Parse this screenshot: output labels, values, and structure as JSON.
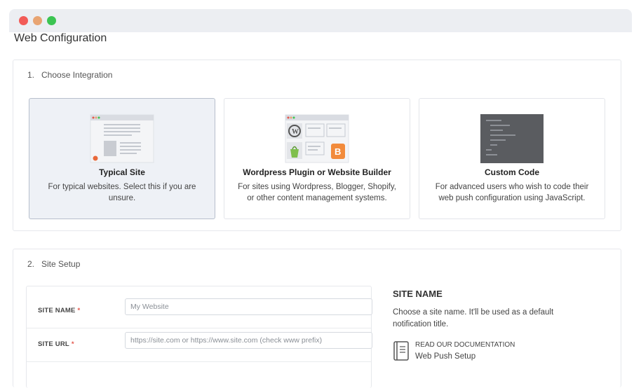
{
  "page": {
    "title": "Web Configuration"
  },
  "section1": {
    "number": "1.",
    "title": "Choose Integration",
    "cards": [
      {
        "title": "Typical Site",
        "description": "For typical websites. Select this if you are unsure.",
        "selected": true,
        "icon": "browser-page-illustration"
      },
      {
        "title": "Wordpress Plugin or Website Builder",
        "description": "For sites using Wordpress, Blogger, Shopify, or other content management systems.",
        "selected": false,
        "icon": "cms-logos-illustration"
      },
      {
        "title": "Custom Code",
        "description": "For advanced users who wish to code their web push configuration using JavaScript.",
        "selected": false,
        "icon": "code-editor-illustration"
      }
    ]
  },
  "section2": {
    "number": "2.",
    "title": "Site Setup",
    "fields": [
      {
        "label": "SITE NAME",
        "required": "*",
        "placeholder": "My Website",
        "value": ""
      },
      {
        "label": "SITE URL",
        "required": "*",
        "placeholder": "https://site.com or https://www.site.com (check www prefix)",
        "value": ""
      }
    ],
    "info": {
      "title": "SITE NAME",
      "description": "Choose a site name. It'll be used as a default notification title.",
      "doc_label": "READ OUR DOCUMENTATION",
      "doc_link": "Web Push Setup"
    }
  },
  "colors": {
    "selected_card_bg": "#eef1f6",
    "required_star": "#e4574c",
    "window_red": "#f25b57",
    "window_orange": "#e8a472",
    "window_green": "#3cc452"
  }
}
